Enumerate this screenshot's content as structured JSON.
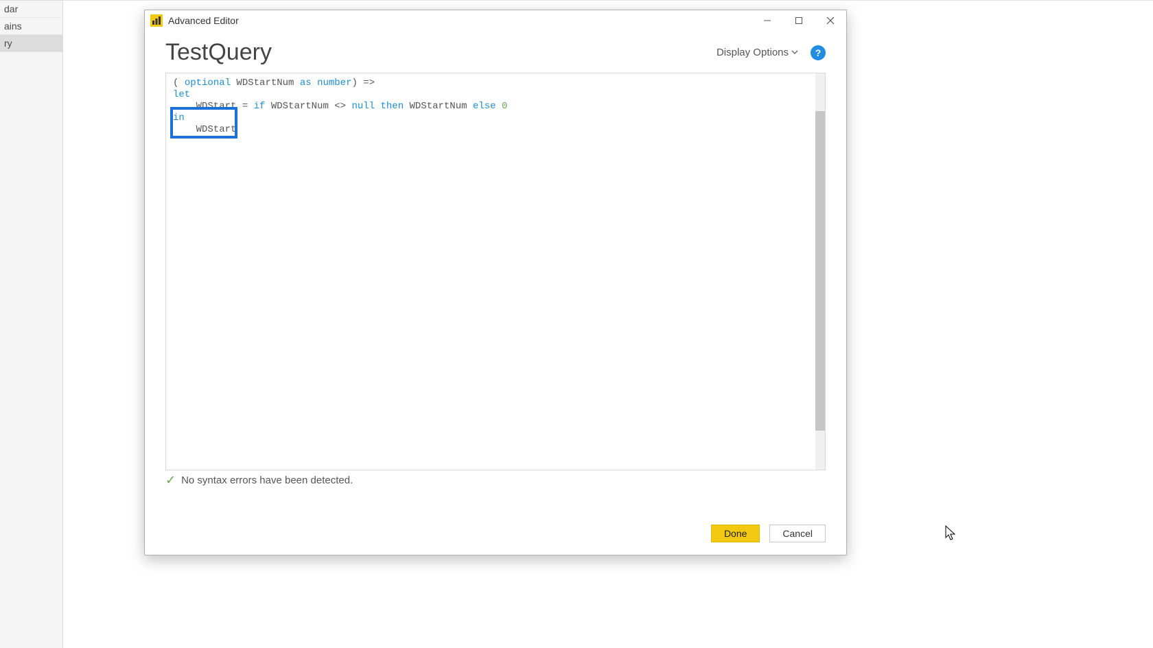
{
  "sidebar": {
    "items": [
      "dar",
      "ains",
      "ry"
    ]
  },
  "titlebar": {
    "title": "Advanced Editor"
  },
  "header": {
    "query_name": "TestQuery",
    "display_options_label": "Display Options",
    "help_label": "?"
  },
  "code": {
    "line1_pre": "( ",
    "line1_kw1": "optional",
    "line1_mid": " WDStartNum ",
    "line1_kw2": "as",
    "line1_sp": " ",
    "line1_kw3": "number",
    "line1_post": ") =>",
    "line2_kw": "let",
    "line3_pre": "    WDStart = ",
    "line3_kw1": "if",
    "line3_mid1": " WDStartNum <> ",
    "line3_kw2": "null",
    "line3_sp1": " ",
    "line3_kw3": "then",
    "line3_mid2": " WDStartNum ",
    "line3_kw4": "else",
    "line3_sp2": " ",
    "line3_num": "0",
    "line4_kw": "in",
    "line5_text": "    WDStart"
  },
  "status": {
    "message": "No syntax errors have been detected."
  },
  "footer": {
    "done": "Done",
    "cancel": "Cancel"
  }
}
